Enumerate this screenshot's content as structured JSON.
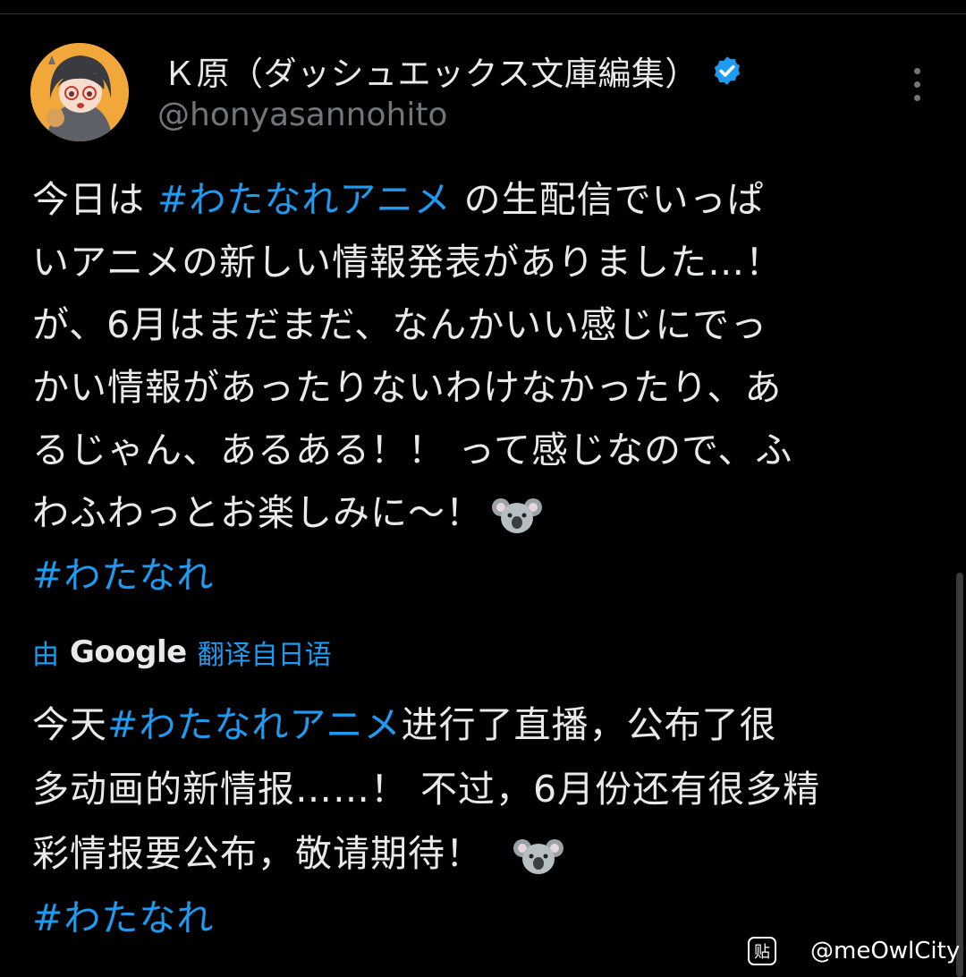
{
  "tweet": {
    "author_name": "Ｋ原（ダッシュエックス文庫編集）",
    "handle": "@honyasannohito",
    "verified_color": "#1d9bf0",
    "avatar_icon": "anime-girl-avatar",
    "lines": [
      {
        "pre": "今日は ",
        "tag": "#わたなれアニメ",
        "post": " の生配信でいっぱ"
      },
      {
        "pre": "いアニメの新しい情報発表がありました…！",
        "tag": "",
        "post": ""
      },
      {
        "pre": "が、6月はまだまだ、なんかいい感じにでっ",
        "tag": "",
        "post": ""
      },
      {
        "pre": "かい情報があったりないわけなかったり、あ",
        "tag": "",
        "post": ""
      },
      {
        "pre": "るじゃん、あるある！！ って感じなので、ふ",
        "tag": "",
        "post": ""
      },
      {
        "pre": "わふわっとお楽しみに～！",
        "tag": "",
        "post": ""
      }
    ],
    "emoji": "koala-emoji",
    "hashtag_footer": "#わたなれ"
  },
  "translation": {
    "prefix": "由",
    "google": "Google",
    "suffix": "翻译自日语",
    "lines": [
      {
        "pre": "今天",
        "tag": "#わたなれアニメ",
        "post": "进行了直播，公布了很"
      },
      {
        "pre": "多动画的新情报……！ 不过，6月份还有很多精",
        "tag": "",
        "post": ""
      },
      {
        "pre": "彩情报要公布，敬请期待！",
        "tag": "",
        "post": ""
      }
    ],
    "hashtag_footer": "#わたなれ"
  },
  "watermark": {
    "logo": "贴",
    "text": "@meOwlCity"
  },
  "colors": {
    "background": "#000000",
    "text": "#e7e9ea",
    "muted": "#71767b",
    "link": "#1d9bf0"
  }
}
